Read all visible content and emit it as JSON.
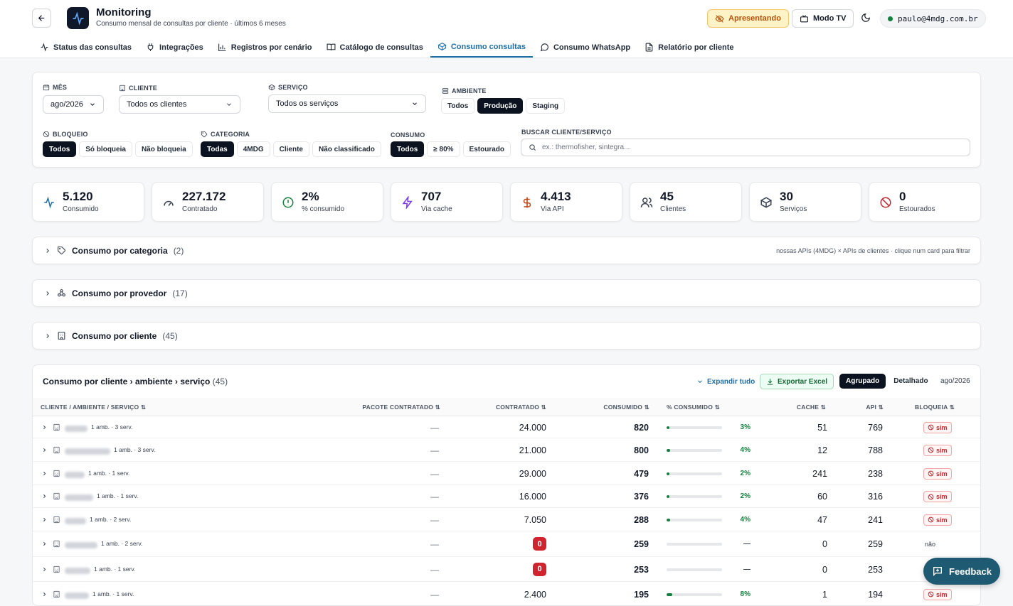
{
  "header": {
    "title": "Monitoring",
    "subtitle": "Consumo mensal de consultas por cliente · últimos 6 meses",
    "presenting_label": "Apresentando",
    "tv_label": "Modo TV",
    "user_email": "paulo@4mdg.com.br"
  },
  "tabs": [
    {
      "label": "Status das consultas",
      "icon": "activity-icon"
    },
    {
      "label": "Integrações",
      "icon": "plug-icon"
    },
    {
      "label": "Registros por cenário",
      "icon": "bar-chart-icon"
    },
    {
      "label": "Catálogo de consultas",
      "icon": "book-icon"
    },
    {
      "label": "Consumo consultas",
      "icon": "box-icon",
      "active": true
    },
    {
      "label": "Consumo WhatsApp",
      "icon": "chat-icon"
    },
    {
      "label": "Relatório por cliente",
      "icon": "file-icon"
    }
  ],
  "filters": {
    "month": {
      "label": "Mês",
      "value": "ago/2026"
    },
    "client": {
      "label": "Cliente",
      "value": "Todos os clientes"
    },
    "service": {
      "label": "Serviço",
      "value": "Todos os serviços"
    },
    "environment": {
      "label": "Ambiente",
      "options": [
        "Todos",
        "Produção",
        "Staging"
      ],
      "selected": "Produção"
    },
    "blocking": {
      "label": "Bloqueio",
      "options": [
        "Todos",
        "Só bloqueia",
        "Não bloqueia"
      ],
      "selected": "Todos"
    },
    "category": {
      "label": "Categoria",
      "options": [
        "Todas",
        "4MDG",
        "Cliente",
        "Não classificado"
      ],
      "selected": "Todas"
    },
    "consumption": {
      "label": "Consumo",
      "options": [
        "Todos",
        "≥ 80%",
        "Estourado"
      ],
      "selected": "Todos"
    },
    "search": {
      "label": "Buscar cliente/serviço",
      "placeholder": "ex.: thermofisher, sintegra..."
    }
  },
  "stats": [
    {
      "value": "5.120",
      "label": "Consumido",
      "icon": "activity-icon",
      "color": "#1d6fa8"
    },
    {
      "value": "227.172",
      "label": "Contratado",
      "icon": "gauge-icon",
      "color": "#374151"
    },
    {
      "value": "2%",
      "label": "% consumido",
      "icon": "alert-circle-icon",
      "color": "#15803d"
    },
    {
      "value": "707",
      "label": "Via cache",
      "icon": "zap-icon",
      "color": "#7c3aed"
    },
    {
      "value": "4.413",
      "label": "Via API",
      "icon": "dollar-icon",
      "color": "#c2410c"
    },
    {
      "value": "45",
      "label": "Clientes",
      "icon": "users-icon",
      "color": "#374151"
    },
    {
      "value": "30",
      "label": "Serviços",
      "icon": "box-icon",
      "color": "#374151"
    },
    {
      "value": "0",
      "label": "Estourados",
      "icon": "ban-icon",
      "color": "#c0262d"
    }
  ],
  "sections": [
    {
      "title": "Consumo por categoria",
      "count": "(2)",
      "hint": "nossas APIs (4MDG) × APIs de clientes · clique num card para filtrar",
      "icon": "tag-icon"
    },
    {
      "title": "Consumo por provedor",
      "count": "(17)",
      "hint": "",
      "icon": "network-icon"
    },
    {
      "title": "Consumo por cliente",
      "count": "(45)",
      "hint": "",
      "icon": "building-icon"
    }
  ],
  "table": {
    "title": "Consumo por cliente › ambiente › serviço",
    "count": "(45)",
    "expand_label": "Expandir tudo",
    "export_label": "Exportar Excel",
    "view_options": [
      "Agrupado",
      "Detalhado"
    ],
    "view_selected": "Agrupado",
    "period": "ago/2026",
    "columns": [
      "CLIENTE / AMBIENTE / SERVIÇO",
      "PACOTE CONTRATADO",
      "CONTRATADO",
      "CONSUMIDO",
      "% CONSUMIDO",
      "CACHE",
      "API",
      "BLOQUEIA"
    ],
    "rows": [
      {
        "meta": "1 amb. · 3 serv.",
        "package": "—",
        "contracted": "24.000",
        "consumed": "820",
        "pct": "3%",
        "pct_value": 0.03,
        "cache": "51",
        "api": "769",
        "blocks": "sim"
      },
      {
        "meta": "1 amb. · 3 serv.",
        "package": "—",
        "contracted": "21.000",
        "consumed": "800",
        "pct": "4%",
        "pct_value": 0.04,
        "cache": "12",
        "api": "788",
        "blocks": "sim"
      },
      {
        "meta": "1 amb. · 1 serv.",
        "package": "—",
        "contracted": "29.000",
        "consumed": "479",
        "pct": "2%",
        "pct_value": 0.02,
        "cache": "241",
        "api": "238",
        "blocks": "sim"
      },
      {
        "meta": "1 amb. · 1 serv.",
        "package": "—",
        "contracted": "16.000",
        "consumed": "376",
        "pct": "2%",
        "pct_value": 0.02,
        "cache": "60",
        "api": "316",
        "blocks": "sim"
      },
      {
        "meta": "1 amb. · 2 serv.",
        "package": "—",
        "contracted": "7.050",
        "consumed": "288",
        "pct": "4%",
        "pct_value": 0.04,
        "cache": "47",
        "api": "241",
        "blocks": "sim"
      },
      {
        "meta": "1 amb. · 2 serv.",
        "package": "—",
        "contracted": "0",
        "consumed": "259",
        "pct": "—",
        "pct_value": 0,
        "cache": "0",
        "api": "259",
        "blocks": "não"
      },
      {
        "meta": "1 amb. · 1 serv.",
        "package": "—",
        "contracted": "0",
        "consumed": "253",
        "pct": "—",
        "pct_value": 0,
        "cache": "0",
        "api": "253",
        "blocks": ""
      },
      {
        "meta": "1 amb. · 1 serv.",
        "package": "—",
        "contracted": "2.400",
        "consumed": "195",
        "pct": "8%",
        "pct_value": 0.08,
        "cache": "1",
        "api": "194",
        "blocks": "sim"
      }
    ]
  },
  "feedback_label": "Feedback"
}
